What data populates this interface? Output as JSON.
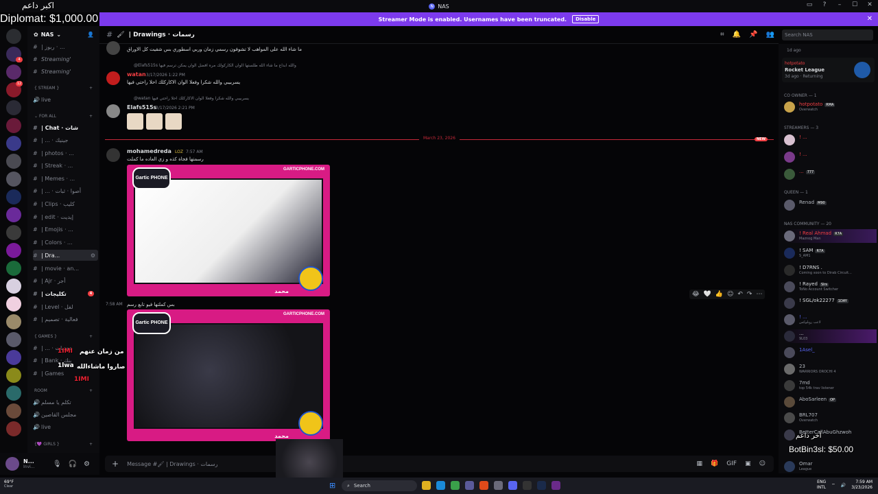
{
  "window": {
    "title": "NAS"
  },
  "overlay": {
    "top_text": "اكبر داعم",
    "money": "Diplomat: $1,000.00",
    "bottom_label": "آخر داعم",
    "bottom_money": "BotBin3sl: $50.00",
    "chat_lines": [
      "من زمان عنهم",
      "الرسامين كثير صاروا ماشاءالله"
    ],
    "chat_names": [
      "1IMI",
      "1lwa",
      "1IMI"
    ]
  },
  "banner": {
    "text": "Streamer Mode is enabled. Usernames have been truncated.",
    "button": "Disable"
  },
  "server": {
    "name": "NAS"
  },
  "channels": [
    {
      "label": "| ربوز · ...",
      "type": "text"
    },
    {
      "label": "Streaming'",
      "type": "text",
      "italic": true
    },
    {
      "label": "Streaming'",
      "type": "text",
      "italic": true
    },
    {
      "label": "live",
      "type": "voice"
    },
    {
      "label": "| Chat · شات",
      "type": "text",
      "bold": true
    },
    {
      "label": "| ... · جينيك",
      "type": "text"
    },
    {
      "label": "| photos · ...",
      "type": "text"
    },
    {
      "label": "| Streak · ...",
      "type": "text"
    },
    {
      "label": "| Memes · ...",
      "type": "text"
    },
    {
      "label": "| ... · أصوا · ثبات",
      "type": "text"
    },
    {
      "label": "| Clips · كليب",
      "type": "text"
    },
    {
      "label": "| edit · إيديت",
      "type": "text"
    },
    {
      "label": "| Emojis · ...",
      "type": "text"
    },
    {
      "label": "| Colors · ...",
      "type": "text"
    },
    {
      "label": "| Dra...",
      "type": "text",
      "active": true
    },
    {
      "label": "| movie · an...",
      "type": "text"
    },
    {
      "label": "| Ajr · أجر",
      "type": "text"
    },
    {
      "label": "| تكليجات",
      "type": "text",
      "badge": "4"
    },
    {
      "label": "| Level · لفل",
      "type": "text"
    },
    {
      "label": "| فعالية · تصميم",
      "type": "text"
    },
    {
      "label": "| ... · تحديات",
      "type": "text"
    },
    {
      "label": "| Bank · بنك",
      "type": "text"
    },
    {
      "label": "| Games",
      "type": "text"
    },
    {
      "label": "تكلم يا مسلم",
      "type": "voice"
    },
    {
      "label": "مجلس القاصين",
      "type": "voice"
    },
    {
      "label": "live",
      "type": "voice"
    }
  ],
  "categories": {
    "stream": "STREAM",
    "forall": "For All",
    "games": "GAMES",
    "room": "Room",
    "girls": "girls"
  },
  "channel_header": {
    "name": "| Drawings · رسمات"
  },
  "search": {
    "placeholder": "Search NAS"
  },
  "messages": {
    "m1_text": "ما شاء الله على المواهب لا تشوفون رسمي زمان وربي اسطوري بس شقيت كل الاوراق",
    "reply1": "@Elafs515s والله ابداع ما شاء الله طلستها الوان الكاركولك مره افضل الوان يمكن ترسم فيها",
    "m2_user": "watan",
    "m2_time": "3/17/2026 1:22 PM",
    "m2_text": "يسربيبي والله شكرا وفعلا الوان الاكاركلك احلا راحتي فيها",
    "reply2": "@watan يسربيبي والله شكرا وفعلا الوان الاكاركلك احلا راحتي فيها",
    "m3_user": "Elafs515s",
    "m3_time": "3/17/2026 2:21 PM",
    "date_divider": "March 23, 2026",
    "new_label": "NEW",
    "m4_user": "mohamedreda",
    "m4_tag": "LOZ",
    "m4_time": "7:57 AM",
    "m4_text": "رسمتها فجاة كذه و زي العاده ما كملت",
    "m5_time": "7:58 AM",
    "m5_text": "بس كملتها فيو تابع رسم",
    "gartic_site": "GARTICPHONE.COM",
    "gartic_brand": "Gartic PHONE",
    "gartic_author": "محمد"
  },
  "composer": {
    "placeholder": "Message #🖌 | Drawings · رسمات"
  },
  "user_panel": {
    "name": "N...",
    "sub": "Invi..."
  },
  "members": {
    "activity_game": "Rocket League",
    "activity_user": "hotpotato",
    "activity_sub": "3d ago · Returning",
    "top_sub": "1d ago",
    "co_owner_cat": "Co Owner — 1",
    "co_owner": {
      "name": "hotpotato",
      "tag": "RMA",
      "status": "Overwatch"
    },
    "streamers_cat": "STREAMERS — 3",
    "streamers": [
      {
        "name": "! ...",
        "status": ""
      },
      {
        "name": "! ...",
        "status": ""
      },
      {
        "name": "...",
        "tag": "777",
        "status": ""
      }
    ],
    "queen_cat": "Queen — 1",
    "queen": {
      "name": "Renad",
      "tag": "M90"
    },
    "community_cat": "NAS COMMUNITY — 20",
    "community": [
      {
        "name": "! Real Ahmad",
        "tag": "R7A",
        "status": "Maznog Man"
      },
      {
        "name": "! SAM",
        "tag": "R7A",
        "status": "S_AM1"
      },
      {
        "name": "! D7RNS .",
        "status": "Coming soon to Dirab Circuit..."
      },
      {
        "name": "! Rayed",
        "tag": "Slrs",
        "status": "ToNo Account Switcher"
      },
      {
        "name": "! SGL/ok22277",
        "tag": "1DAY",
        "status": ""
      },
      {
        "name": "! ...",
        "status": "لاعب روبلوكس"
      },
      {
        "name": "...",
        "status": "9L03"
      },
      {
        "name": "1Asel_",
        "status": ""
      },
      {
        "name": "23",
        "status": "WARRIORS OROCHI 4"
      },
      {
        "name": "7md",
        "status": "top 54k trav listener"
      },
      {
        "name": "AboSarleen",
        "tag": "OP",
        "status": ""
      },
      {
        "name": "BRL707",
        "status": "Overwatch"
      },
      {
        "name": "BetterCallAbuGhzwoh",
        "status": ""
      },
      {
        "name": "Omar",
        "status": "League"
      }
    ]
  },
  "taskbar": {
    "weather_temp": "69°F",
    "weather_desc": "Clear",
    "search": "Search",
    "lang": "ENG",
    "lang2": "INTL",
    "time": "7:59 AM",
    "date": "3/23/2026"
  },
  "colors": {
    "accent": "#5865f2",
    "banner": "#7c3aed",
    "gartic_pink": "#d81b84",
    "new_red": "#f23f43",
    "watan": "#f23f43",
    "elafs": "#dbdee1"
  }
}
